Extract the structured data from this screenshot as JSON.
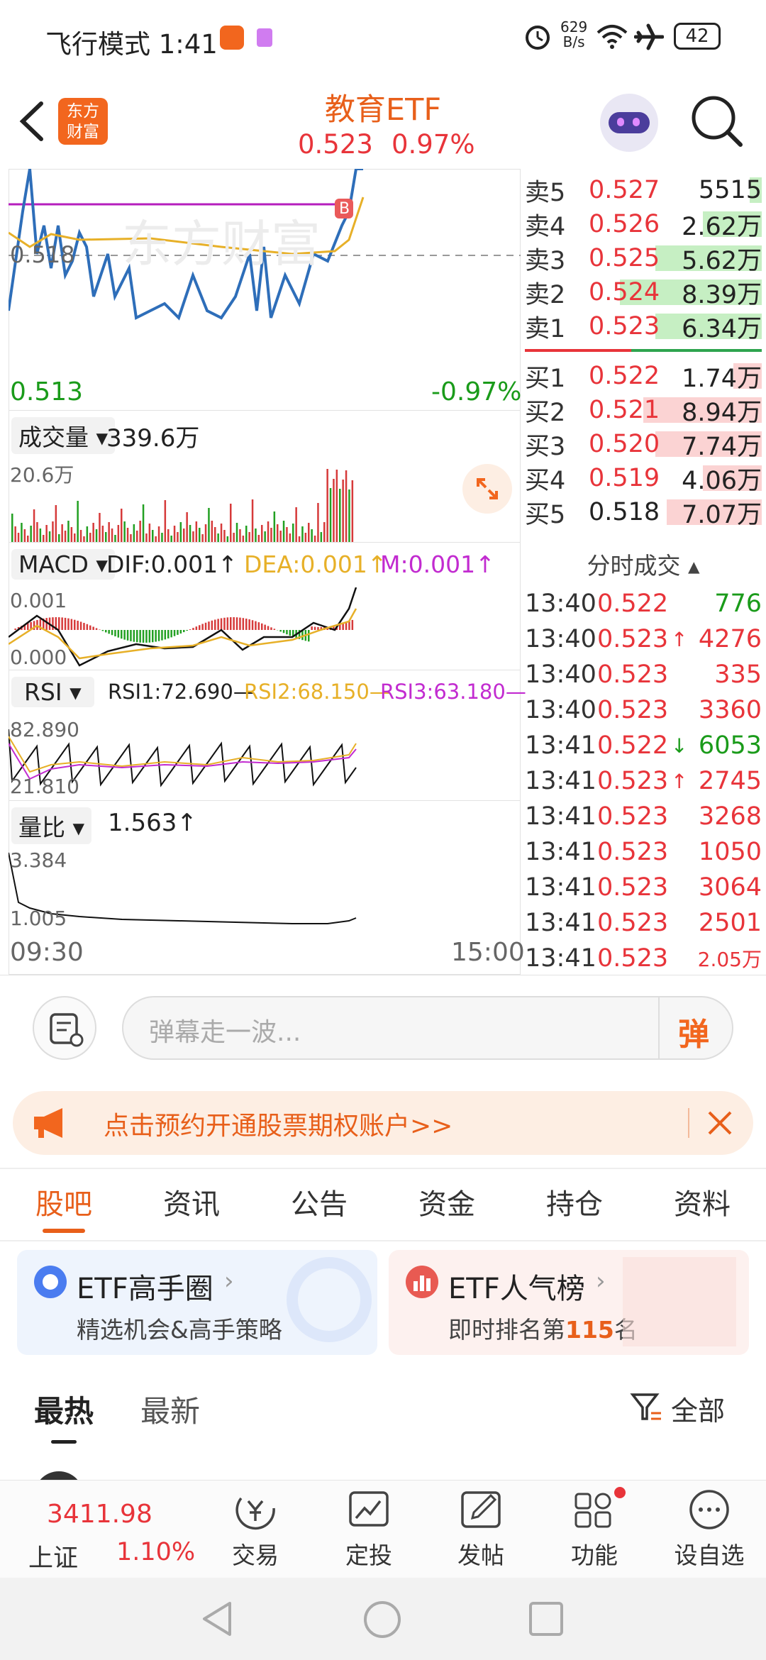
{
  "status_bar": {
    "mode_time": "飞行模式 1:41",
    "net_speed_top": "629",
    "net_speed_unit": "B/s",
    "battery": "42"
  },
  "header": {
    "title": "教育ETF",
    "price": "0.523",
    "change_pct": "0.97%",
    "logo_line1": "东方",
    "logo_line2": "财富"
  },
  "intraday": {
    "ref_price": "0.518",
    "low_price": "0.513",
    "low_pct": "-0.97%",
    "marker": "B",
    "watermark": "东方财富"
  },
  "volume": {
    "selector": "成交量",
    "value": "339.6万",
    "axis_top": "20.6万"
  },
  "macd": {
    "selector": "MACD",
    "dif": "DIF:0.001",
    "dea": "DEA:0.001",
    "m": "M:0.001",
    "axis_top": "0.001",
    "axis_bottom": "0.000"
  },
  "rsi": {
    "selector": "RSI",
    "rsi1": "RSI1:72.690",
    "rsi2": "RSI2:68.150",
    "rsi3": "RSI3:63.180",
    "axis_top": "82.890",
    "axis_bottom": "21.810"
  },
  "vol_ratio": {
    "selector": "量比",
    "value": "1.563",
    "axis_top": "3.384",
    "axis_bottom": "1.005"
  },
  "time_axis": {
    "start": "09:30",
    "end": "15:00"
  },
  "order_book": {
    "asks": [
      {
        "label": "卖5",
        "price": "0.527",
        "vol": "5515",
        "bar": 0.05
      },
      {
        "label": "卖4",
        "price": "0.526",
        "vol": "2.62万",
        "bar": 0.25
      },
      {
        "label": "卖3",
        "price": "0.525",
        "vol": "5.62万",
        "bar": 0.45
      },
      {
        "label": "卖2",
        "price": "0.524",
        "vol": "8.39万",
        "bar": 0.6
      },
      {
        "label": "卖1",
        "price": "0.523",
        "vol": "6.34万",
        "bar": 0.45
      }
    ],
    "bids": [
      {
        "label": "买1",
        "price": "0.522",
        "vol": "1.74万",
        "bar": 0.12
      },
      {
        "label": "买2",
        "price": "0.521",
        "vol": "8.94万",
        "bar": 0.5
      },
      {
        "label": "买3",
        "price": "0.520",
        "vol": "7.74万",
        "bar": 0.45
      },
      {
        "label": "买4",
        "price": "0.519",
        "vol": "4.06万",
        "bar": 0.25
      },
      {
        "label": "买5",
        "price": "0.518",
        "vol": "7.07万",
        "bar": 0.4
      }
    ]
  },
  "trades": {
    "header": "分时成交",
    "rows": [
      {
        "time": "13:40",
        "price": "0.522",
        "vol": "776",
        "dir": "",
        "color": "#1a9b1a",
        "pcolor": "#e8343a"
      },
      {
        "time": "13:40",
        "price": "0.523",
        "vol": "4276",
        "dir": "↑",
        "color": "#e8343a",
        "pcolor": "#e8343a"
      },
      {
        "time": "13:40",
        "price": "0.523",
        "vol": "335",
        "dir": "",
        "color": "#e8343a",
        "pcolor": "#e8343a"
      },
      {
        "time": "13:40",
        "price": "0.523",
        "vol": "3360",
        "dir": "",
        "color": "#e8343a",
        "pcolor": "#e8343a"
      },
      {
        "time": "13:41",
        "price": "0.522",
        "vol": "6053",
        "dir": "↓",
        "color": "#1a9b1a",
        "pcolor": "#e8343a"
      },
      {
        "time": "13:41",
        "price": "0.523",
        "vol": "2745",
        "dir": "↑",
        "color": "#e8343a",
        "pcolor": "#e8343a"
      },
      {
        "time": "13:41",
        "price": "0.523",
        "vol": "3268",
        "dir": "",
        "color": "#e8343a",
        "pcolor": "#e8343a"
      },
      {
        "time": "13:41",
        "price": "0.523",
        "vol": "1050",
        "dir": "",
        "color": "#e8343a",
        "pcolor": "#e8343a"
      },
      {
        "time": "13:41",
        "price": "0.523",
        "vol": "3064",
        "dir": "",
        "color": "#e8343a",
        "pcolor": "#e8343a"
      },
      {
        "time": "13:41",
        "price": "0.523",
        "vol": "2501",
        "dir": "",
        "color": "#e8343a",
        "pcolor": "#e8343a"
      },
      {
        "time": "13:41",
        "price": "0.523",
        "vol": "2.05万",
        "dir": "",
        "color": "#e8343a",
        "pcolor": "#e8343a"
      }
    ]
  },
  "comment": {
    "placeholder": "弹幕走一波...",
    "danmu_btn": "弹"
  },
  "promo": {
    "text": "点击预约开通股票期权账户>>"
  },
  "tabs": [
    "股吧",
    "资讯",
    "公告",
    "资金",
    "持仓",
    "资料"
  ],
  "cards": [
    {
      "title": "ETF高手圈",
      "sub": "精选机会&高手策略"
    },
    {
      "title": "ETF人气榜",
      "sub_pre": "即时排名第",
      "rank": "115",
      "sub_post": "名"
    }
  ],
  "sort": {
    "hot": "最热",
    "new": "最新",
    "filter": "全部"
  },
  "bottom": {
    "index_value": "3411.98",
    "index_name": "上证",
    "index_pct": "1.10%",
    "items": [
      "交易",
      "定投",
      "发帖",
      "功能",
      "设自选"
    ]
  },
  "colors": {
    "accent": "#e85f1a",
    "up": "#e8343a",
    "down": "#1a9b1a"
  }
}
